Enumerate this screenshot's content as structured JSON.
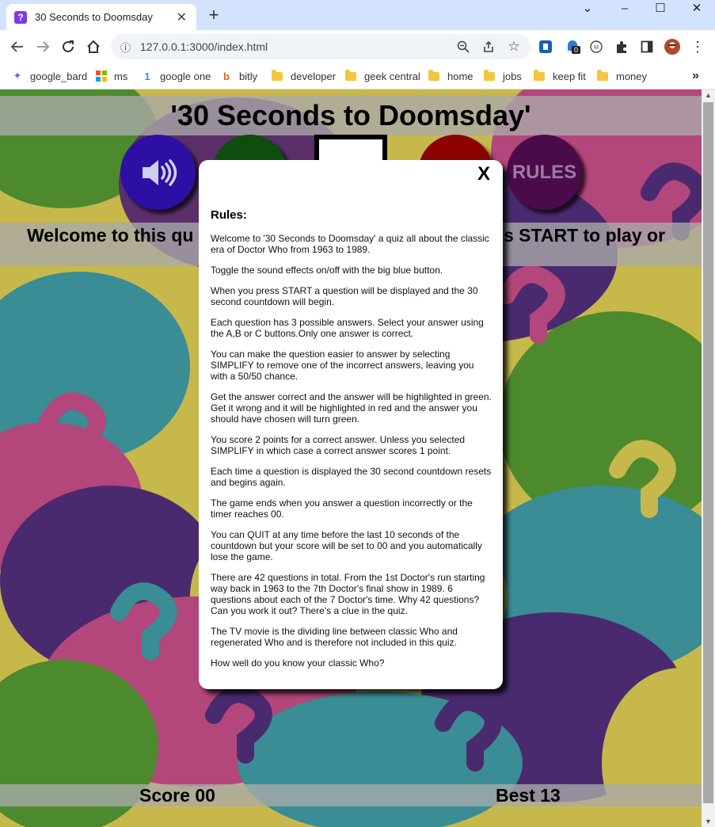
{
  "browser": {
    "tab_title": "30 Seconds to Doomsday",
    "tab_icon": "question-mark-favicon",
    "url": "127.0.0.1:3000/index.html",
    "bookmarks": [
      {
        "label": "google_bard",
        "icon": "sparkle-icon"
      },
      {
        "label": "ms",
        "icon": "microsoft-icon"
      },
      {
        "label": "google one",
        "icon": "google-one-icon"
      },
      {
        "label": "bitly",
        "icon": "bitly-icon"
      },
      {
        "label": "developer",
        "icon": "folder-icon"
      },
      {
        "label": "geek central",
        "icon": "folder-icon"
      },
      {
        "label": "home",
        "icon": "folder-icon"
      },
      {
        "label": "jobs",
        "icon": "folder-icon"
      },
      {
        "label": "keep fit",
        "icon": "folder-icon"
      },
      {
        "label": "money",
        "icon": "folder-icon"
      }
    ],
    "extension_badge": "0"
  },
  "game": {
    "title": "'30 Seconds to Doomsday'",
    "welcome_left": "Welcome to this qu",
    "welcome_right": "s START to play or",
    "rules_button": "RULES",
    "score_label": "Score 00",
    "best_label": "Best 13",
    "colors": {
      "sound_button": "#2d0fa3",
      "start_button": "#0d4d0d",
      "quit_button": "#8b0000",
      "rules_button": "#4a0b4a",
      "rules_text": "#9e7aa0"
    }
  },
  "modal": {
    "close_label": "X",
    "heading": "Rules:",
    "paragraphs": [
      "Welcome to '30 Seconds to Doomsday' a quiz all about the classic era of Doctor Who from 1963 to 1989.",
      "Toggle the sound effects on/off with the big blue button.",
      "When you press START a question will be displayed and the 30 second countdown will begin.",
      "Each question has 3 possible answers. Select your answer using the A,B or C buttons.Only one answer is correct.",
      "You can make the question easier to answer by selecting SIMPLIFY to remove one of the incorrect answers, leaving you with a 50/50 chance.",
      "Get the answer correct and the answer will be highlighted in green. Get it wrong and it will be highlighted in red and the answer you should have chosen will turn green.",
      "You score 2 points for a correct answer. Unless you selected SIMPLIFY in which case a correct answer scores 1 point.",
      "Each time a question is displayed the 30 second countdown resets and begins again.",
      "The game ends when you answer a question incorrectly or the timer reaches 00.",
      "You can QUIT at any time before the last 10 seconds of the countdown but your score will be set to 00 and you automatically lose the game.",
      "There are 42 questions in total. From the 1st Doctor's run starting way back in 1963 to the 7th Doctor's final show in 1989. 6 questions about each of the 7 Doctor's time. Why 42 questions? Can you work it out? There's a clue in the quiz.",
      "The TV movie is the dividing line between classic Who and regenerated Who and is therefore not included in this quiz.",
      "How well do you know your classic Who?"
    ]
  }
}
